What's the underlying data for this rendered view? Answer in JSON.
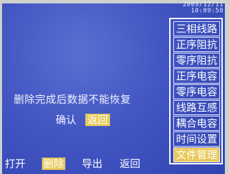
{
  "clock": {
    "date": "2009/12/11",
    "time": "10:09:58"
  },
  "menu": {
    "items": [
      {
        "label": "三相线路",
        "selected": false
      },
      {
        "label": "正序阻抗",
        "selected": false
      },
      {
        "label": "零序阻抗",
        "selected": false
      },
      {
        "label": "正序电容",
        "selected": false
      },
      {
        "label": "零序电容",
        "selected": false
      },
      {
        "label": "线路互感",
        "selected": false
      },
      {
        "label": "耦合电容",
        "selected": false
      },
      {
        "label": "时间设置",
        "selected": false
      },
      {
        "label": "文件管理",
        "selected": true
      }
    ]
  },
  "dialog": {
    "message": "删除完成后数据不能恢复",
    "confirm_label": "确认",
    "back_label": "返回"
  },
  "softkeys": {
    "open": "打开",
    "delete": "删除",
    "export": "导出",
    "back": "返回"
  },
  "colors": {
    "screen_bg": "#4255c2",
    "highlight": "#e7c85b",
    "text": "#ffffff"
  }
}
